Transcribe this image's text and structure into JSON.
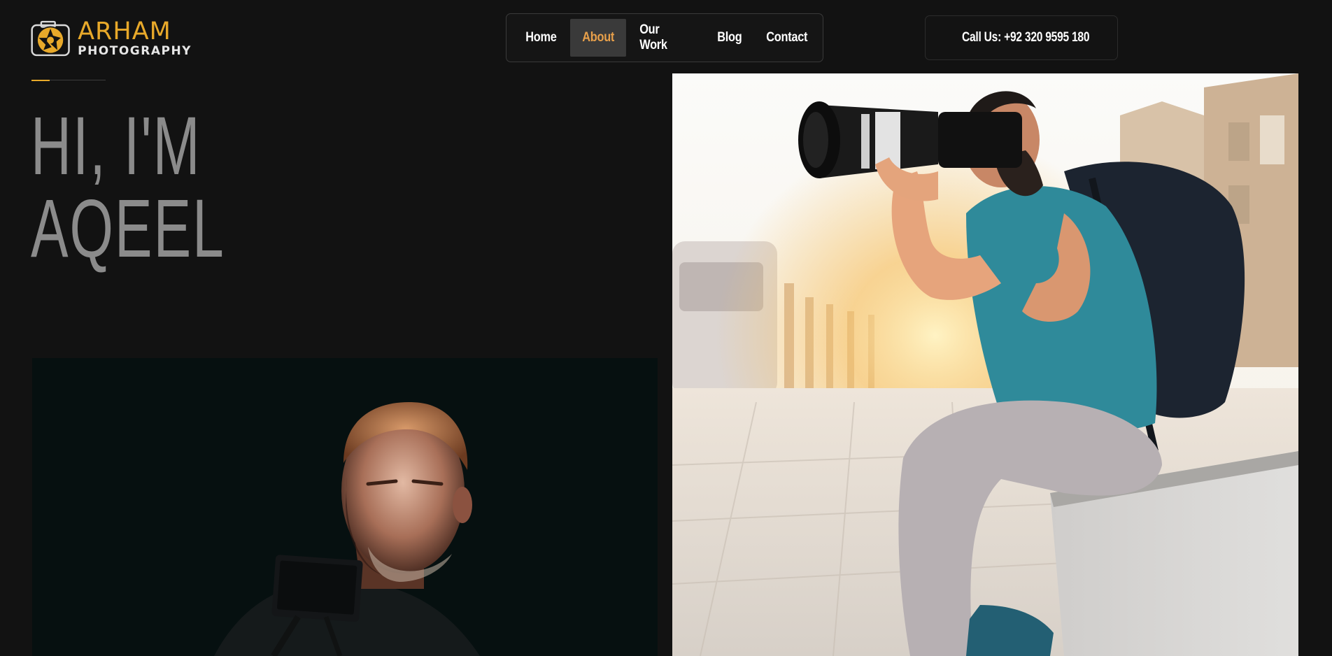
{
  "brand": {
    "name": "ARHAM",
    "tagline": "PHOTOGRAPHY",
    "accent_color": "#e8a92a"
  },
  "nav": {
    "items": [
      {
        "label": "Home"
      },
      {
        "label": "About",
        "active": true
      },
      {
        "label": "Our Work"
      },
      {
        "label": "Blog"
      },
      {
        "label": "Contact"
      }
    ],
    "active_color": "#e8a04a"
  },
  "call": {
    "icon": "phone-icon",
    "label": "Call Us: +92 320 9595 180"
  },
  "hero": {
    "line1": "HI, I'M",
    "line2": "AQEEL"
  },
  "images": {
    "left": {
      "icon": "photographer-portrait-image"
    },
    "right": {
      "icon": "photographer-street-image"
    }
  }
}
